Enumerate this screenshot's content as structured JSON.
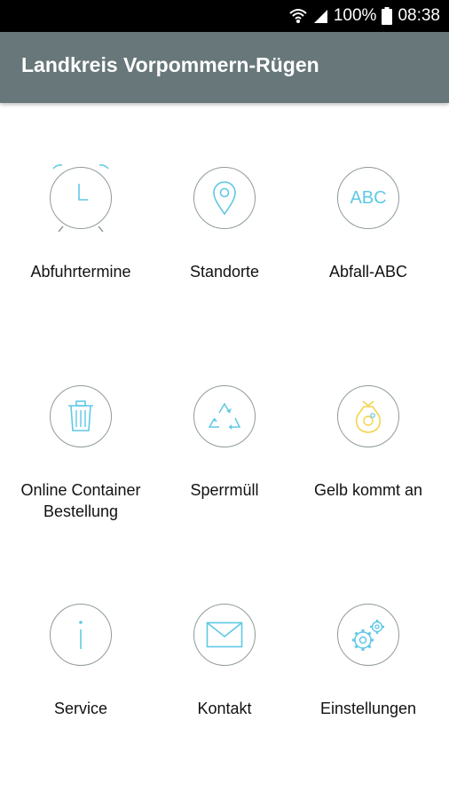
{
  "status_bar": {
    "battery": "100%",
    "time": "08:38"
  },
  "app_bar": {
    "title": "Landkreis Vorpommern-Rügen"
  },
  "menu": [
    {
      "label": "Abfuhrtermine",
      "icon": "alarm-clock-icon"
    },
    {
      "label": "Standorte",
      "icon": "location-pin-icon"
    },
    {
      "label": "Abfall-ABC",
      "icon": "abc-icon",
      "icon_text": "ABC"
    },
    {
      "label": "Online Container Bestellung",
      "icon": "trash-can-icon"
    },
    {
      "label": "Sperrmüll",
      "icon": "recycle-icon"
    },
    {
      "label": "Gelb kommt an",
      "icon": "yellow-bag-icon"
    },
    {
      "label": "Service",
      "icon": "info-icon"
    },
    {
      "label": "Kontakt",
      "icon": "mail-icon"
    },
    {
      "label": "Einstellungen",
      "icon": "gears-icon"
    }
  ],
  "colors": {
    "app_bar": "#67777a",
    "icon_accent": "#5fc8e6",
    "yellow_bag": "#f3d34a",
    "circle_border": "#8f9a9c"
  }
}
